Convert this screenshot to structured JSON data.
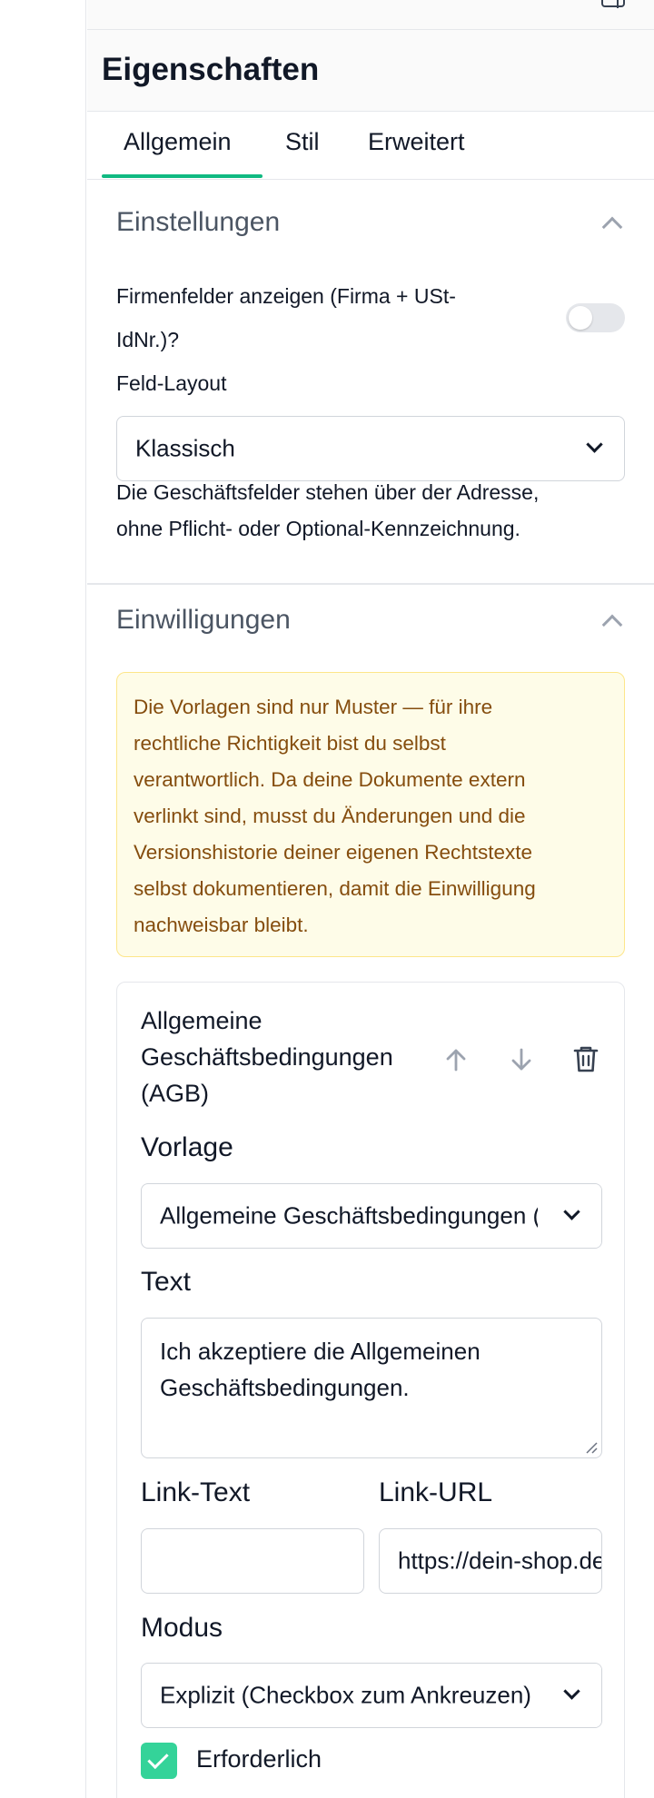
{
  "panel": {
    "title": "Eigenschaften",
    "tabs": [
      {
        "label": "Allgemein",
        "active": true
      },
      {
        "label": "Stil",
        "active": false
      },
      {
        "label": "Erweitert",
        "active": false
      }
    ]
  },
  "settings": {
    "heading": "Einstellungen",
    "company_fields_label_line1": "Firmenfelder anzeigen (Firma + USt-",
    "company_fields_label_line2": "IdNr.)?",
    "company_fields_enabled": false,
    "layout_label": "Feld-Layout",
    "layout_value": "Klassisch",
    "layout_help_line1": "Die Geschäftsfelder stehen über der Adresse,",
    "layout_help_line2": "ohne Pflicht- oder Optional-Kennzeichnung."
  },
  "consents": {
    "heading": "Einwilligungen",
    "notice_lines": [
      "Die Vorlagen sind nur Muster — für ihre",
      "rechtliche Richtigkeit bist du selbst",
      "verantwortlich. Da deine Dokumente extern",
      "verlinkt sind, musst du Änderungen und die",
      "Versionshistorie deiner eigenen Rechtstexte",
      "selbst dokumentieren, damit die Einwilligung",
      "nachweisbar bleibt."
    ],
    "item": {
      "title_lines": [
        "Allgemeine",
        "Geschäftsbedingungen",
        "(AGB)"
      ],
      "template_label": "Vorlage",
      "template_value": "Allgemeine Geschäftsbedingungen (AGB)",
      "text_label": "Text",
      "text_line1": "Ich akzeptiere die Allgemeinen",
      "text_line2": "Geschäftsbedingungen.",
      "link_text_label": "Link-Text",
      "link_text_value": "",
      "link_url_label": "Link-URL",
      "link_url_value": "https://dein-shop.de/agb",
      "mode_label": "Modus",
      "mode_value": "Explizit (Checkbox zum Ankreuzen)",
      "required_label": "Erforderlich",
      "required_checked": true
    }
  },
  "colors": {
    "accent": "#10b981",
    "checkbox": "#34d399",
    "notice_bg": "#fefce8",
    "notice_border": "#fde68a",
    "notice_text": "#854d0e"
  },
  "icons": [
    "panel-layout-icon",
    "chevron-up-icon",
    "chevron-down-icon",
    "arrow-up-icon",
    "arrow-down-icon",
    "trash-icon",
    "check-icon",
    "resize-grip-icon"
  ]
}
